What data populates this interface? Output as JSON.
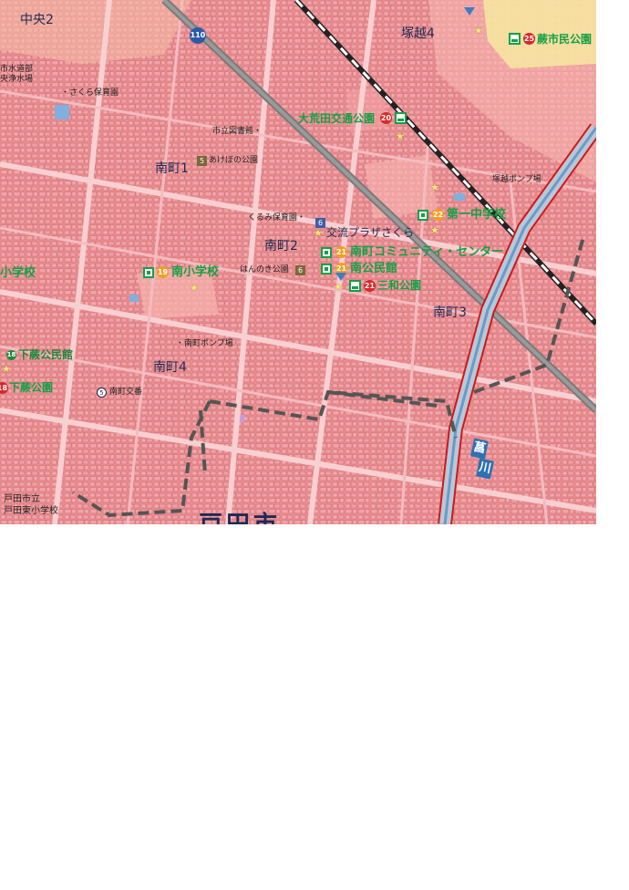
{
  "map": {
    "town_labels": {
      "chuo2": "中央2",
      "tsukagoshi4": "塚越4",
      "minamicho1": "南町1",
      "minamicho2": "南町2",
      "minamicho3": "南町3",
      "minamicho4": "南町4",
      "city": "戸田市"
    },
    "facilities": {
      "water_plant": [
        "市水道部",
        "央浄水場"
      ],
      "sakura_nursery": "・さくら保育園",
      "library": "市立図書館・",
      "akebono_park": "あけぼの公園",
      "kurumi_nursery": "くるみ保育園・",
      "hannoki_park": "はんのき公園",
      "koryu_plaza": "交流プラザさくら",
      "pump_tsukagoshi": "塚越ポンプ場",
      "pump_minami": "・南町ポンプ場",
      "koban": "南町交番",
      "school_left": "小学校",
      "toda_school": [
        "戸田市立",
        "戸田東小学校"
      ]
    },
    "shelters": [
      {
        "num": "25",
        "label": "蕨市民公園"
      },
      {
        "num": "20",
        "label": "大荒田交通公園"
      },
      {
        "num": "22",
        "label": "第一中学校"
      },
      {
        "num": "21",
        "label": "南町コミュニティ・センター"
      },
      {
        "num": "21",
        "label": "南公民館"
      },
      {
        "num": "21",
        "label": "三和公園"
      },
      {
        "num": "19",
        "label": "南小学校"
      },
      {
        "num": "18",
        "label": "下蕨公民館"
      },
      {
        "num": "18",
        "label": "下蕨公園"
      }
    ],
    "icons": {
      "akebono_num": "5",
      "hannoki_num": "6",
      "koryu_num": "6",
      "koban_num": "5",
      "route": "110",
      "river": [
        "菖",
        "川"
      ]
    }
  }
}
